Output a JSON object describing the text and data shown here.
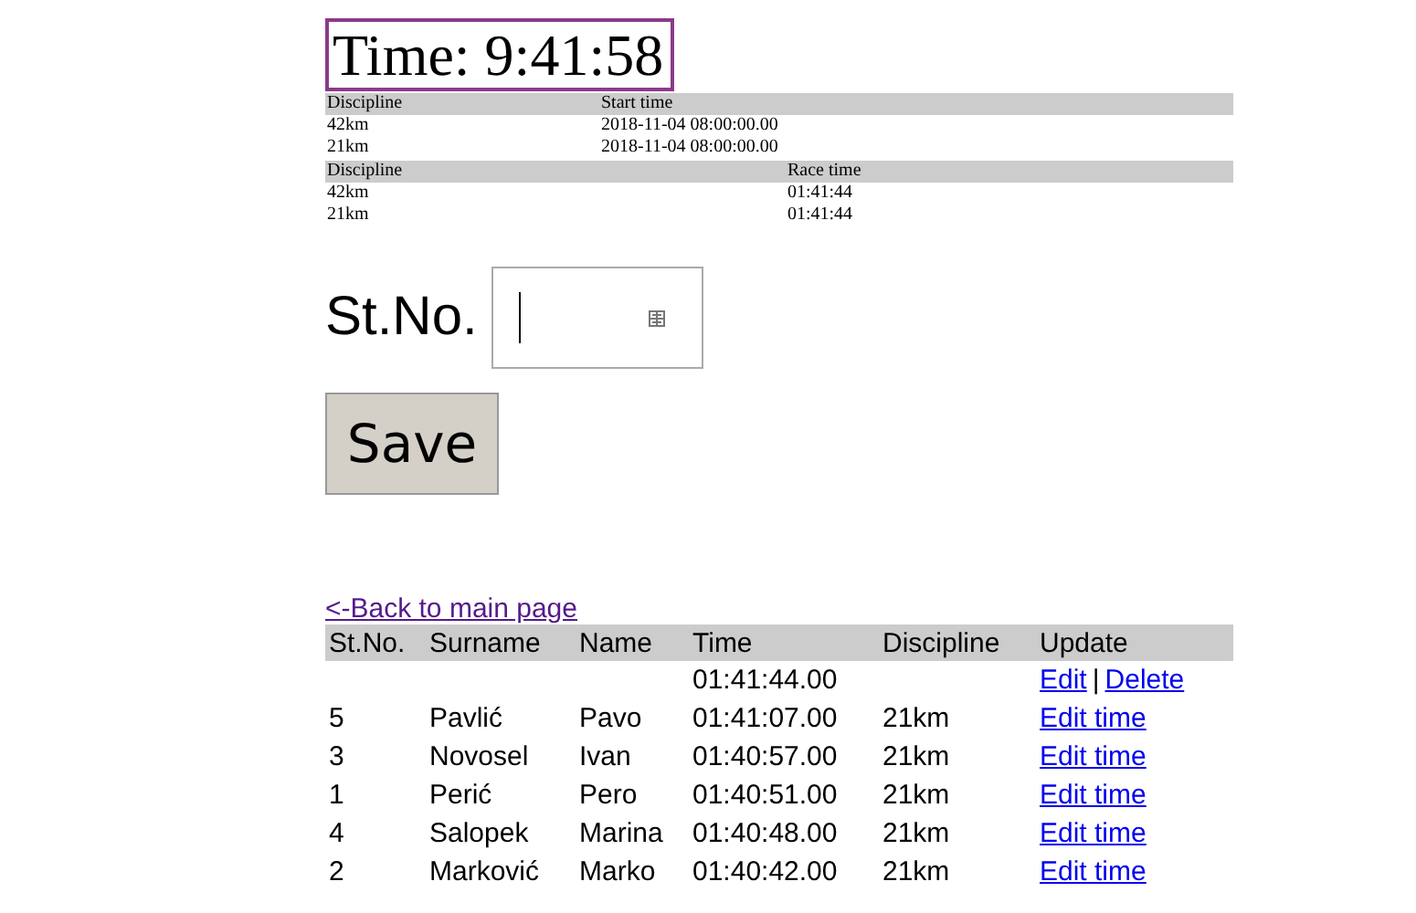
{
  "clock": {
    "text": "Time: 9:41:58"
  },
  "start_table": {
    "columns": [
      "Discipline",
      "Start time"
    ],
    "rows": [
      [
        "42km",
        "2018-11-04 08:00:00.00"
      ],
      [
        "21km",
        "2018-11-04 08:00:00.00"
      ]
    ]
  },
  "race_table": {
    "columns": [
      "Discipline",
      "Race time"
    ],
    "rows": [
      [
        "42km",
        "01:41:44"
      ],
      [
        "21km",
        "01:41:44"
      ]
    ]
  },
  "form": {
    "label": "St.No.",
    "save_button": "Save"
  },
  "back_link": {
    "text": "<-Back to main page",
    "visited": true
  },
  "results": {
    "columns": [
      "St.No.",
      "Surname",
      "Name",
      "Time",
      "Discipline",
      "Update"
    ],
    "rows": [
      {
        "time": "01:41:44.00",
        "update": {
          "kind": "edit-delete",
          "links": [
            "Edit",
            "Delete"
          ],
          "separator": "|"
        }
      },
      {
        "st_no": "5",
        "surname": "Pavlić",
        "name": "Pavo",
        "time": "01:41:07.00",
        "discipline": "21km",
        "update": {
          "kind": "edit-time",
          "links": [
            "Edit time"
          ]
        }
      },
      {
        "st_no": "3",
        "surname": "Novosel",
        "name": "Ivan",
        "time": "01:40:57.00",
        "discipline": "21km",
        "update": {
          "kind": "edit-time",
          "links": [
            "Edit time"
          ]
        }
      },
      {
        "st_no": "1",
        "surname": "Perić",
        "name": "Pero",
        "time": "01:40:51.00",
        "discipline": "21km",
        "update": {
          "kind": "edit-time",
          "links": [
            "Edit time"
          ]
        }
      },
      {
        "st_no": "4",
        "surname": "Salopek",
        "name": "Marina",
        "time": "01:40:48.00",
        "discipline": "21km",
        "update": {
          "kind": "edit-time",
          "links": [
            "Edit time"
          ]
        }
      },
      {
        "st_no": "2",
        "surname": "Marković",
        "name": "Marko",
        "time": "01:40:42.00",
        "discipline": "21km",
        "update": {
          "kind": "edit-time",
          "links": [
            "Edit time"
          ]
        }
      }
    ]
  }
}
